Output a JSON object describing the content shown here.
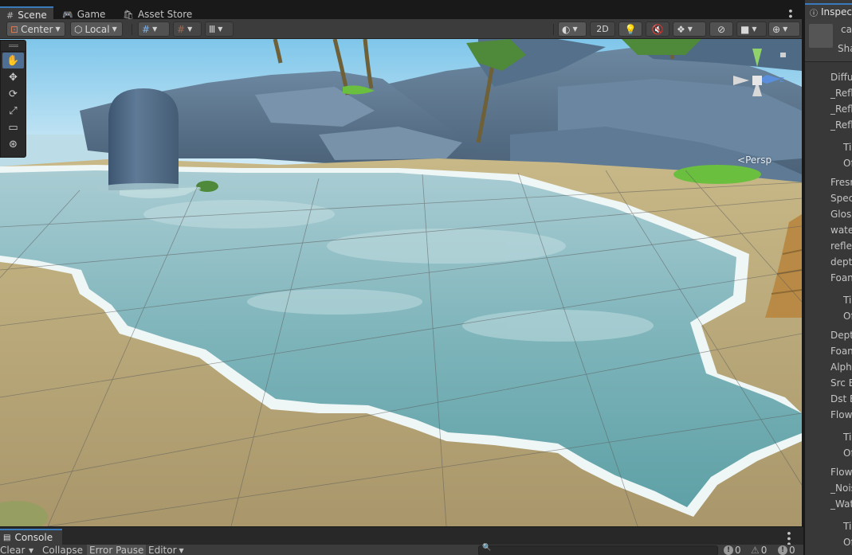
{
  "scene_tabs": {
    "scene": "Scene",
    "game": "Game",
    "asset_store": "Asset Store"
  },
  "toolbar": {
    "pivot": "Center",
    "space": "Local",
    "mode_2d": "2D"
  },
  "viewport": {
    "projection_label": "Persp",
    "gizmo_axes": {
      "y": "y",
      "z": "z"
    }
  },
  "inspector": {
    "tab": "Inspec",
    "material_name": "ca",
    "shader_label": "Sha",
    "properties": [
      "Diffu",
      "_Refl",
      "_Refl",
      "_Refl",
      "Ti",
      "Of",
      "Fresn",
      "Spec",
      "Gloss",
      "wate",
      "reflec",
      "depth",
      "Foan",
      "Ti",
      "Of",
      "Dept",
      "Foan",
      "Alpha",
      "Src B",
      "Dst B",
      "Flow",
      "Ti",
      "Of",
      "Flow",
      "_Nois",
      "_Wat",
      "Ti",
      "Of"
    ]
  },
  "console": {
    "tab": "Console",
    "clear": "Clear",
    "collapse": "Collapse",
    "error_pause": "Error Pause",
    "editor": "Editor",
    "log_count": "0",
    "warning_count": "0",
    "error_count": "0"
  },
  "colors": {
    "accent": "#3a79bb",
    "panel": "#383838",
    "toolbar": "#3c3c3c",
    "sand": "#b9a77c",
    "water": "#7fb8bf",
    "rock": "#5b7691",
    "sky": "#a9d8ef"
  },
  "icons": {
    "scene_tab": "hash-icon",
    "game_tab": "gamepad-icon",
    "asset_store_tab": "bag-icon",
    "inspector_tab": "info-icon",
    "console_tab": "console-icon"
  }
}
